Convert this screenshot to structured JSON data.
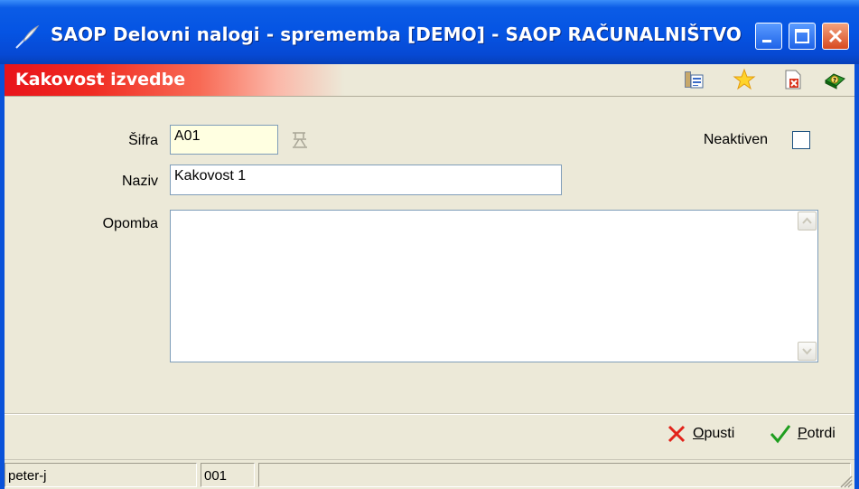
{
  "window": {
    "title": "SAOP Delovni nalogi - sprememba [DEMO] - SAOP RAČUNALNIŠTVO"
  },
  "header": {
    "title": "Kakovost izvedbe",
    "icons": [
      "report-icon",
      "star-icon",
      "delete-document-icon",
      "help-book-icon"
    ]
  },
  "form": {
    "sifra_label": "Šifra",
    "sifra_value": "A01",
    "naziv_label": "Naziv",
    "naziv_value": "Kakovost 1",
    "opomba_label": "Opomba",
    "opomba_value": "",
    "neaktiven_label": "Neaktiven",
    "neaktiven_checked": false
  },
  "buttons": {
    "cancel_hotkey": "O",
    "cancel_rest": "pusti",
    "confirm_hotkey": "P",
    "confirm_rest": "otrdi"
  },
  "statusbar": {
    "user": "peter-j",
    "code": "001",
    "extra": ""
  },
  "colors": {
    "titlebar": "#0554e3",
    "header_red": "#e8131a",
    "client_bg": "#ece9d8",
    "sifra_field_bg": "#ffffe1"
  }
}
